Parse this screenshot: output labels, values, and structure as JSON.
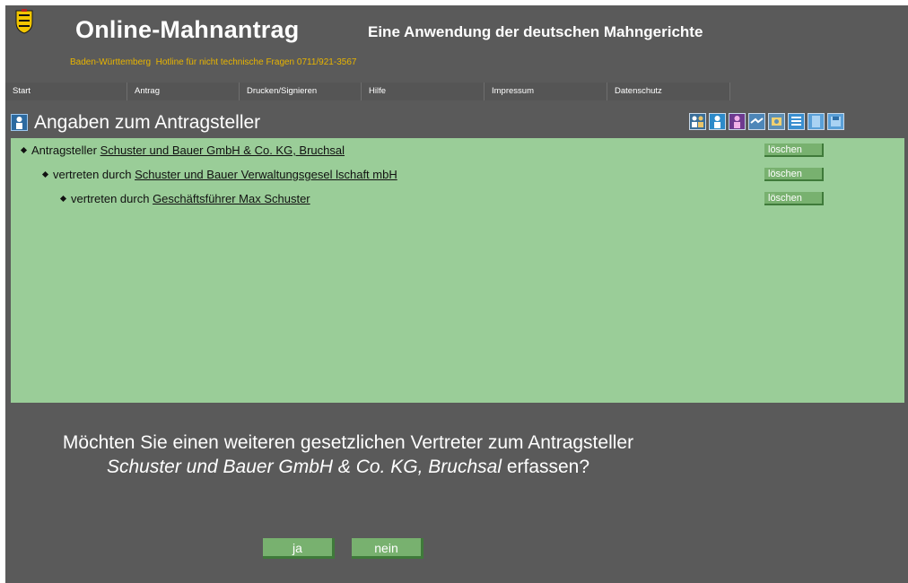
{
  "header": {
    "title": "Online-Mahnantrag",
    "subtitle": "Eine Anwendung der deutschen Mahngerichte",
    "hotline": "Baden-Württemberg  Hotline für nicht technische Fragen 0711/921-3567"
  },
  "menu": [
    "Start",
    "Antrag",
    "Drucken/Signieren",
    "Hilfe",
    "Impressum",
    "Datenschutz"
  ],
  "section": {
    "title": "Angaben zum Antragsteller",
    "toolbar_icons": [
      "persons-icon",
      "person-icon",
      "person-purple-icon",
      "handshake-icon",
      "money-icon",
      "list-icon",
      "document-icon",
      "save-icon"
    ]
  },
  "entries": [
    {
      "prefix": "Antragsteller",
      "link": "Schuster und Bauer GmbH & Co. KG, Bruchsal",
      "delete": "löschen"
    },
    {
      "prefix": "vertreten durch",
      "link": "Schuster und Bauer Verwaltungsgesel lschaft mbH",
      "delete": "löschen"
    },
    {
      "prefix": "vertreten durch",
      "link": "Geschäftsführer Max Schuster",
      "delete": "löschen"
    }
  ],
  "question": {
    "part1": "Möchten Sie einen weiteren gesetzlichen Vertreter zum Antragsteller ",
    "name": "Schuster und Bauer GmbH & Co. KG, Bruchsal",
    "part2": " erfassen?"
  },
  "buttons": {
    "yes": "ja",
    "no": "nein"
  },
  "colors": {
    "background": "#5a5a5a",
    "panel": "#9acd98",
    "accent": "#e8b400",
    "button": "#78b16f"
  }
}
